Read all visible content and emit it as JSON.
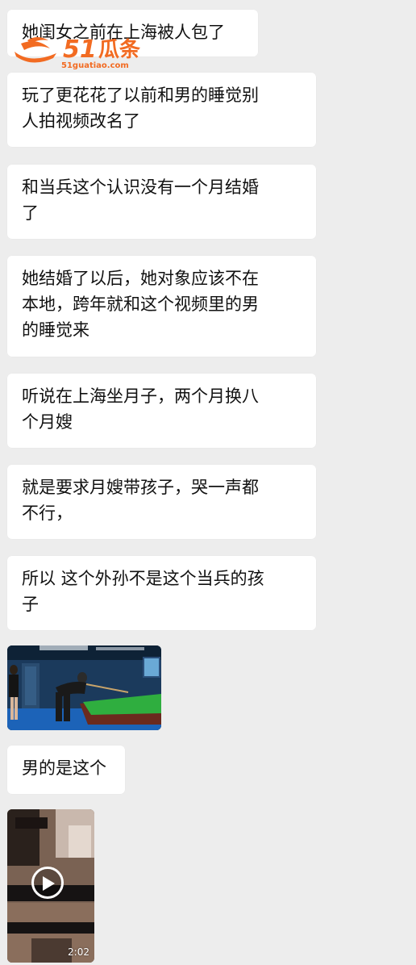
{
  "messages": [
    {
      "lines": [
        "她闺女之前在上海被人包了"
      ]
    },
    {
      "lines": [
        "玩了更花花了以前和男的睡觉别",
        "人拍视频改名了"
      ]
    },
    {
      "lines": [
        "和当兵这个认识没有一个月结婚",
        "了"
      ]
    },
    {
      "lines": [
        "她结婚了以后，她对象应该不在",
        "本地，跨年就和这个视频里的男",
        "的睡觉来"
      ]
    },
    {
      "lines": [
        "听说在上海坐月子，两个月换八",
        "个月嫂"
      ]
    },
    {
      "lines": [
        "就是要求月嫂带孩子，哭一声都",
        "不行，"
      ]
    },
    {
      "lines": [
        "所以 这个外孙不是这个当兵的孩",
        "子"
      ]
    },
    {
      "lines": [
        "男的是这个"
      ]
    }
  ],
  "watermark": {
    "brand": "51瓜条",
    "url": "51guatiao.com"
  },
  "image_message": {
    "icon": "photo-thumbnail"
  },
  "video_message": {
    "duration": "2:02",
    "icon": "play-icon"
  },
  "colors": {
    "background": "#ededed",
    "bubble": "#ffffff",
    "text": "#111111",
    "watermark": "#f26b22"
  }
}
